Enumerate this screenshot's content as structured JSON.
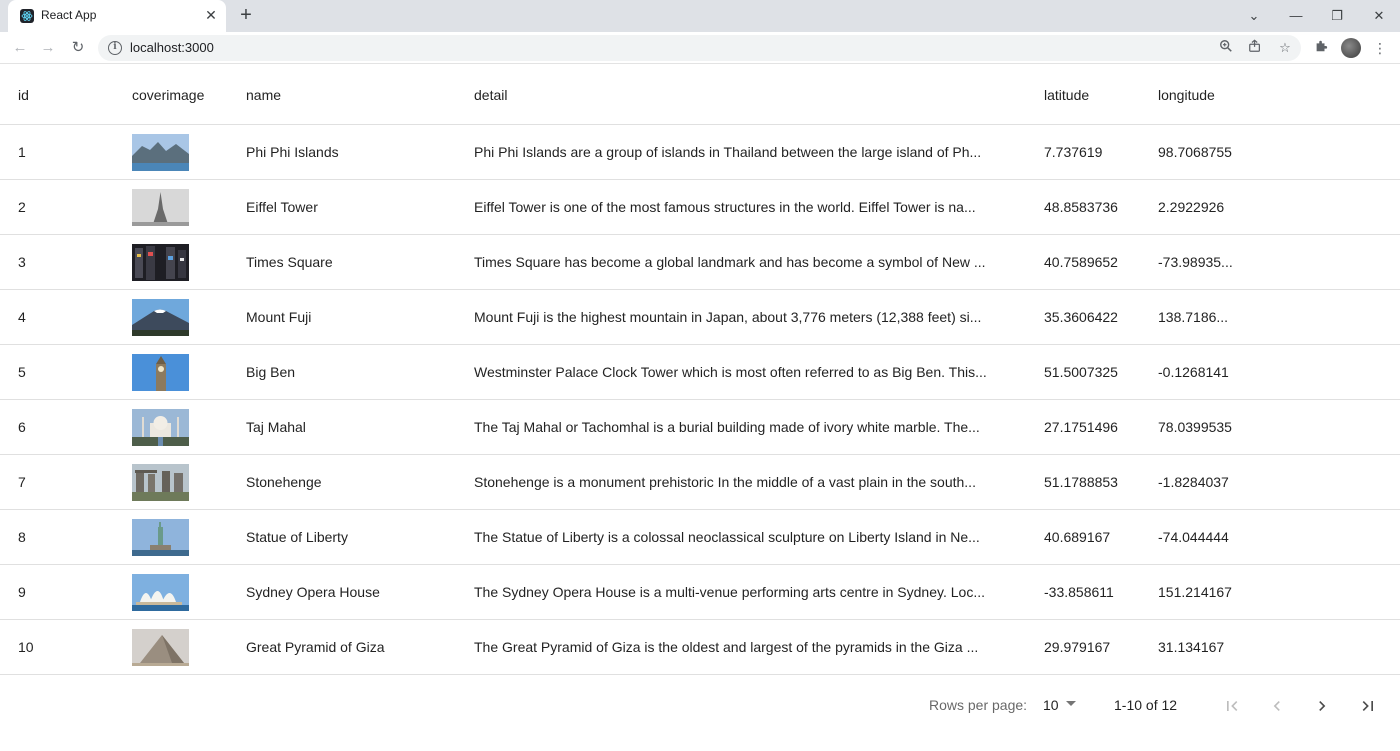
{
  "browser": {
    "tab_title": "React App",
    "url": "localhost:3000"
  },
  "table": {
    "headers": {
      "id": "id",
      "coverimage": "coverimage",
      "name": "name",
      "detail": "detail",
      "latitude": "latitude",
      "longitude": "longitude"
    },
    "rows": [
      {
        "id": "1",
        "name": "Phi Phi Islands",
        "detail": "Phi Phi Islands are a group of islands in Thailand between the large island of Ph...",
        "latitude": "7.737619",
        "longitude": "98.7068755"
      },
      {
        "id": "2",
        "name": "Eiffel Tower",
        "detail": "Eiffel Tower is one of the most famous structures in the world. Eiffel Tower is na...",
        "latitude": "48.8583736",
        "longitude": "2.2922926"
      },
      {
        "id": "3",
        "name": "Times Square",
        "detail": "Times Square has become a global landmark and has become a symbol of New ...",
        "latitude": "40.7589652",
        "longitude": "-73.98935..."
      },
      {
        "id": "4",
        "name": "Mount Fuji",
        "detail": "Mount Fuji is the highest mountain in Japan, about 3,776 meters (12,388 feet) si...",
        "latitude": "35.3606422",
        "longitude": "138.7186..."
      },
      {
        "id": "5",
        "name": "Big Ben",
        "detail": "Westminster Palace Clock Tower which is most often referred to as Big Ben. This...",
        "latitude": "51.5007325",
        "longitude": "-0.1268141"
      },
      {
        "id": "6",
        "name": "Taj Mahal",
        "detail": "The Taj Mahal or Tachomhal is a burial building made of ivory white marble. The...",
        "latitude": "27.1751496",
        "longitude": "78.0399535"
      },
      {
        "id": "7",
        "name": "Stonehenge",
        "detail": "Stonehenge is a monument prehistoric In the middle of a vast plain in the south...",
        "latitude": "51.1788853",
        "longitude": "-1.8284037"
      },
      {
        "id": "8",
        "name": "Statue of Liberty",
        "detail": "The Statue of Liberty is a colossal neoclassical sculpture on Liberty Island in Ne...",
        "latitude": "40.689167",
        "longitude": "-74.044444"
      },
      {
        "id": "9",
        "name": "Sydney Opera House",
        "detail": "The Sydney Opera House is a multi-venue performing arts centre in Sydney. Loc...",
        "latitude": "-33.858611",
        "longitude": "151.214167"
      },
      {
        "id": "10",
        "name": "Great Pyramid of Giza",
        "detail": "The Great Pyramid of Giza is the oldest and largest of the pyramids in the Giza ...",
        "latitude": "29.979167",
        "longitude": "31.134167"
      }
    ]
  },
  "pagination": {
    "rows_per_page_label": "Rows per page:",
    "rows_per_page_value": "10",
    "range": "1-10 of 12"
  }
}
